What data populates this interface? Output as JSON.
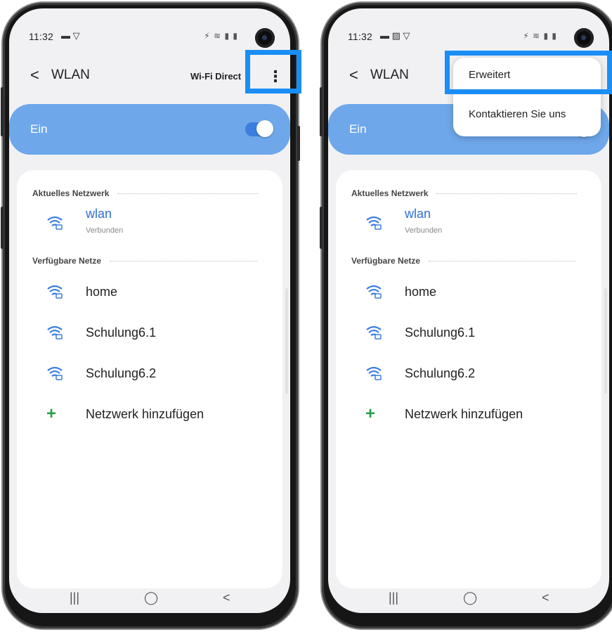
{
  "colors": {
    "accent": "#6ea7ea",
    "switch": "#3b7ee0",
    "highlight": "#1a8ef5",
    "add": "#27a048",
    "link": "#2f6fd6"
  },
  "left": {
    "status": {
      "time": "11:32",
      "indicators": "▬ ▽",
      "system": "⚡ ≋ ▮ ▮"
    },
    "appbar": {
      "back": "<",
      "title": "WLAN",
      "wifi_direct": "Wi-Fi Direct",
      "more": "⋮"
    },
    "toggle": {
      "label": "Ein"
    },
    "current_header": "Aktuelles Netzwerk",
    "current": {
      "name": "wlan",
      "status": "Verbunden"
    },
    "available_header": "Verfügbare Netze",
    "networks": [
      {
        "name": "home"
      },
      {
        "name": "Schulung6.1"
      },
      {
        "name": "Schulung6.2"
      }
    ],
    "add": {
      "icon": "+",
      "label": "Netzwerk hinzufügen"
    },
    "nav": {
      "recents": "|||",
      "home": "◯",
      "back": "<"
    }
  },
  "right": {
    "status": {
      "time": "11:32",
      "indicators": "▬ ▨ ▽",
      "system": "⚡ ≋ ▮ ▮"
    },
    "appbar": {
      "back": "<",
      "title": "WLAN"
    },
    "menu": [
      {
        "label": "Erweitert"
      },
      {
        "label": "Kontaktieren Sie uns"
      }
    ],
    "toggle": {
      "label": "Ein"
    },
    "current_header": "Aktuelles Netzwerk",
    "current": {
      "name": "wlan",
      "status": "Verbunden"
    },
    "available_header": "Verfügbare Netze",
    "networks": [
      {
        "name": "home"
      },
      {
        "name": "Schulung6.1"
      },
      {
        "name": "Schulung6.2"
      }
    ],
    "add": {
      "icon": "+",
      "label": "Netzwerk hinzufügen"
    },
    "nav": {
      "recents": "|||",
      "home": "◯",
      "back": "<"
    }
  }
}
